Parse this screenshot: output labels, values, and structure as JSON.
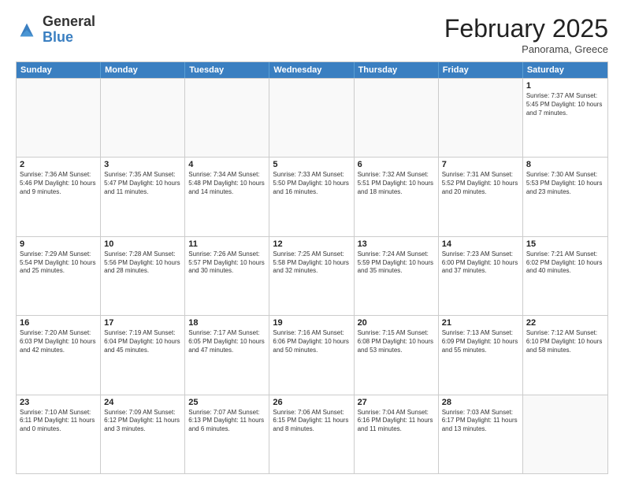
{
  "header": {
    "logo_general": "General",
    "logo_blue": "Blue",
    "month_title": "February 2025",
    "subtitle": "Panorama, Greece"
  },
  "weekdays": [
    "Sunday",
    "Monday",
    "Tuesday",
    "Wednesday",
    "Thursday",
    "Friday",
    "Saturday"
  ],
  "rows": [
    [
      {
        "day": "",
        "info": "",
        "empty": true
      },
      {
        "day": "",
        "info": "",
        "empty": true
      },
      {
        "day": "",
        "info": "",
        "empty": true
      },
      {
        "day": "",
        "info": "",
        "empty": true
      },
      {
        "day": "",
        "info": "",
        "empty": true
      },
      {
        "day": "",
        "info": "",
        "empty": true
      },
      {
        "day": "1",
        "info": "Sunrise: 7:37 AM\nSunset: 5:45 PM\nDaylight: 10 hours\nand 7 minutes.",
        "empty": false
      }
    ],
    [
      {
        "day": "2",
        "info": "Sunrise: 7:36 AM\nSunset: 5:46 PM\nDaylight: 10 hours\nand 9 minutes.",
        "empty": false
      },
      {
        "day": "3",
        "info": "Sunrise: 7:35 AM\nSunset: 5:47 PM\nDaylight: 10 hours\nand 11 minutes.",
        "empty": false
      },
      {
        "day": "4",
        "info": "Sunrise: 7:34 AM\nSunset: 5:48 PM\nDaylight: 10 hours\nand 14 minutes.",
        "empty": false
      },
      {
        "day": "5",
        "info": "Sunrise: 7:33 AM\nSunset: 5:50 PM\nDaylight: 10 hours\nand 16 minutes.",
        "empty": false
      },
      {
        "day": "6",
        "info": "Sunrise: 7:32 AM\nSunset: 5:51 PM\nDaylight: 10 hours\nand 18 minutes.",
        "empty": false
      },
      {
        "day": "7",
        "info": "Sunrise: 7:31 AM\nSunset: 5:52 PM\nDaylight: 10 hours\nand 20 minutes.",
        "empty": false
      },
      {
        "day": "8",
        "info": "Sunrise: 7:30 AM\nSunset: 5:53 PM\nDaylight: 10 hours\nand 23 minutes.",
        "empty": false
      }
    ],
    [
      {
        "day": "9",
        "info": "Sunrise: 7:29 AM\nSunset: 5:54 PM\nDaylight: 10 hours\nand 25 minutes.",
        "empty": false
      },
      {
        "day": "10",
        "info": "Sunrise: 7:28 AM\nSunset: 5:56 PM\nDaylight: 10 hours\nand 28 minutes.",
        "empty": false
      },
      {
        "day": "11",
        "info": "Sunrise: 7:26 AM\nSunset: 5:57 PM\nDaylight: 10 hours\nand 30 minutes.",
        "empty": false
      },
      {
        "day": "12",
        "info": "Sunrise: 7:25 AM\nSunset: 5:58 PM\nDaylight: 10 hours\nand 32 minutes.",
        "empty": false
      },
      {
        "day": "13",
        "info": "Sunrise: 7:24 AM\nSunset: 5:59 PM\nDaylight: 10 hours\nand 35 minutes.",
        "empty": false
      },
      {
        "day": "14",
        "info": "Sunrise: 7:23 AM\nSunset: 6:00 PM\nDaylight: 10 hours\nand 37 minutes.",
        "empty": false
      },
      {
        "day": "15",
        "info": "Sunrise: 7:21 AM\nSunset: 6:02 PM\nDaylight: 10 hours\nand 40 minutes.",
        "empty": false
      }
    ],
    [
      {
        "day": "16",
        "info": "Sunrise: 7:20 AM\nSunset: 6:03 PM\nDaylight: 10 hours\nand 42 minutes.",
        "empty": false
      },
      {
        "day": "17",
        "info": "Sunrise: 7:19 AM\nSunset: 6:04 PM\nDaylight: 10 hours\nand 45 minutes.",
        "empty": false
      },
      {
        "day": "18",
        "info": "Sunrise: 7:17 AM\nSunset: 6:05 PM\nDaylight: 10 hours\nand 47 minutes.",
        "empty": false
      },
      {
        "day": "19",
        "info": "Sunrise: 7:16 AM\nSunset: 6:06 PM\nDaylight: 10 hours\nand 50 minutes.",
        "empty": false
      },
      {
        "day": "20",
        "info": "Sunrise: 7:15 AM\nSunset: 6:08 PM\nDaylight: 10 hours\nand 53 minutes.",
        "empty": false
      },
      {
        "day": "21",
        "info": "Sunrise: 7:13 AM\nSunset: 6:09 PM\nDaylight: 10 hours\nand 55 minutes.",
        "empty": false
      },
      {
        "day": "22",
        "info": "Sunrise: 7:12 AM\nSunset: 6:10 PM\nDaylight: 10 hours\nand 58 minutes.",
        "empty": false
      }
    ],
    [
      {
        "day": "23",
        "info": "Sunrise: 7:10 AM\nSunset: 6:11 PM\nDaylight: 11 hours\nand 0 minutes.",
        "empty": false
      },
      {
        "day": "24",
        "info": "Sunrise: 7:09 AM\nSunset: 6:12 PM\nDaylight: 11 hours\nand 3 minutes.",
        "empty": false
      },
      {
        "day": "25",
        "info": "Sunrise: 7:07 AM\nSunset: 6:13 PM\nDaylight: 11 hours\nand 6 minutes.",
        "empty": false
      },
      {
        "day": "26",
        "info": "Sunrise: 7:06 AM\nSunset: 6:15 PM\nDaylight: 11 hours\nand 8 minutes.",
        "empty": false
      },
      {
        "day": "27",
        "info": "Sunrise: 7:04 AM\nSunset: 6:16 PM\nDaylight: 11 hours\nand 11 minutes.",
        "empty": false
      },
      {
        "day": "28",
        "info": "Sunrise: 7:03 AM\nSunset: 6:17 PM\nDaylight: 11 hours\nand 13 minutes.",
        "empty": false
      },
      {
        "day": "",
        "info": "",
        "empty": true
      }
    ]
  ]
}
